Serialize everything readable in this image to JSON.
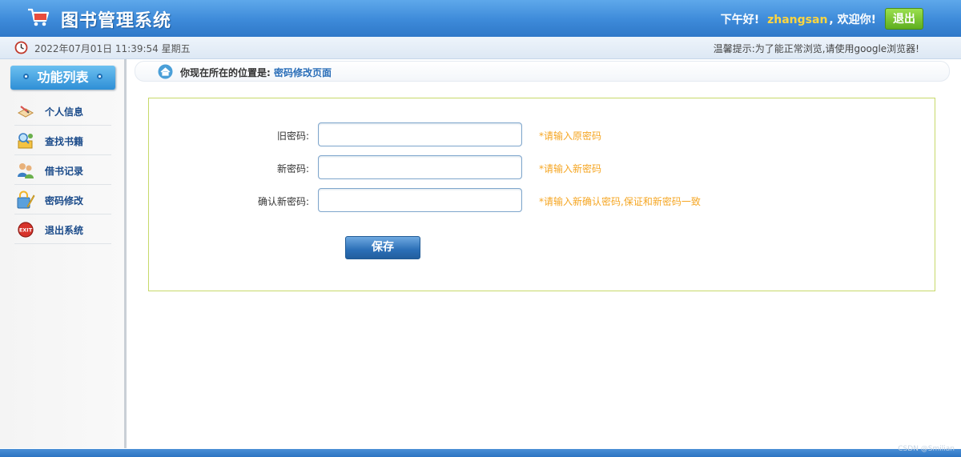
{
  "header": {
    "title": "图书管理系统",
    "greeting": "下午好!",
    "username": "zhangsan",
    "welcome": ", 欢迎你!",
    "logout_label": "退出"
  },
  "infobar": {
    "datetime": "2022年07月01日 11:39:54 星期五",
    "tip": "温馨提示:为了能正常浏览,请使用google浏览器!"
  },
  "sidebar": {
    "title": "功能列表",
    "items": [
      {
        "label": "个人信息",
        "icon": "personal-info-icon"
      },
      {
        "label": "查找书籍",
        "icon": "search-books-icon"
      },
      {
        "label": "借书记录",
        "icon": "borrow-records-icon"
      },
      {
        "label": "密码修改",
        "icon": "change-password-icon"
      },
      {
        "label": "退出系统",
        "icon": "exit-icon"
      }
    ]
  },
  "breadcrumb": {
    "prefix": "你现在所在的位置是:",
    "current": "密码修改页面"
  },
  "form": {
    "old_password": {
      "label": "旧密码:",
      "value": "",
      "hint": "*请输入原密码"
    },
    "new_password": {
      "label": "新密码:",
      "value": "",
      "hint": "*请输入新密码"
    },
    "confirm_password": {
      "label": "确认新密码:",
      "value": "",
      "hint": "*请输入新确认密码,保证和新密码一致"
    },
    "save_label": "保存"
  },
  "watermark": "CSDN @Smilian",
  "colors": {
    "header_blue": "#3d8ad9",
    "username_yellow": "#ffd640",
    "logout_green": "#6cbf2a",
    "hint_orange": "#f5a623",
    "link_blue": "#2a6eb8",
    "panel_border": "#c7d96a"
  }
}
